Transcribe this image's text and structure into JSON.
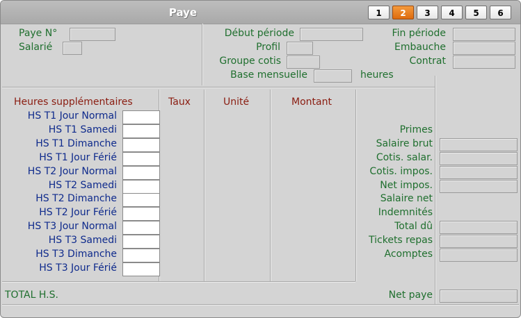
{
  "window": {
    "title": "Paye"
  },
  "tabs": [
    {
      "label": "1",
      "active": false
    },
    {
      "label": "2",
      "active": true
    },
    {
      "label": "3",
      "active": false
    },
    {
      "label": "4",
      "active": false
    },
    {
      "label": "5",
      "active": false
    },
    {
      "label": "6",
      "active": false
    }
  ],
  "header": {
    "paye_no": "Paye N°",
    "salarie": "Salarié",
    "debut_periode": "Début période",
    "profil": "Profil",
    "groupe_cotis": "Groupe cotis",
    "base_mensuelle": "Base mensuelle",
    "heures": "heures",
    "fin_periode": "Fin période",
    "embauche": "Embauche",
    "contrat": "Contrat"
  },
  "table": {
    "col_heures": "Heures supplémentaires",
    "col_taux": "Taux",
    "col_unite": "Unité",
    "col_montant": "Montant",
    "rows": [
      "HS T1 Jour Normal",
      "HS T1 Samedi",
      "HS T1 Dimanche",
      "HS T1 Jour Férié",
      "HS T2 Jour Normal",
      "HS T2 Samedi",
      "HS T2 Dimanche",
      "HS T2 Jour Férié",
      "HS T3 Jour Normal",
      "HS T3 Samedi",
      "HS T3 Dimanche",
      "HS T3 Jour Férié"
    ]
  },
  "summary": {
    "primes": "Primes",
    "salaire_brut": "Salaire brut",
    "cotis_salar": "Cotis. salar.",
    "cotis_impos": "Cotis. impos.",
    "net_impos": "Net impos.",
    "salaire_net": "Salaire net",
    "indemnites": "Indemnités",
    "total_du": "Total dû",
    "tickets_repas": "Tickets repas",
    "acomptes": "Acomptes"
  },
  "footer": {
    "total_hs": "TOTAL H.S.",
    "net_paye": "Net paye"
  }
}
